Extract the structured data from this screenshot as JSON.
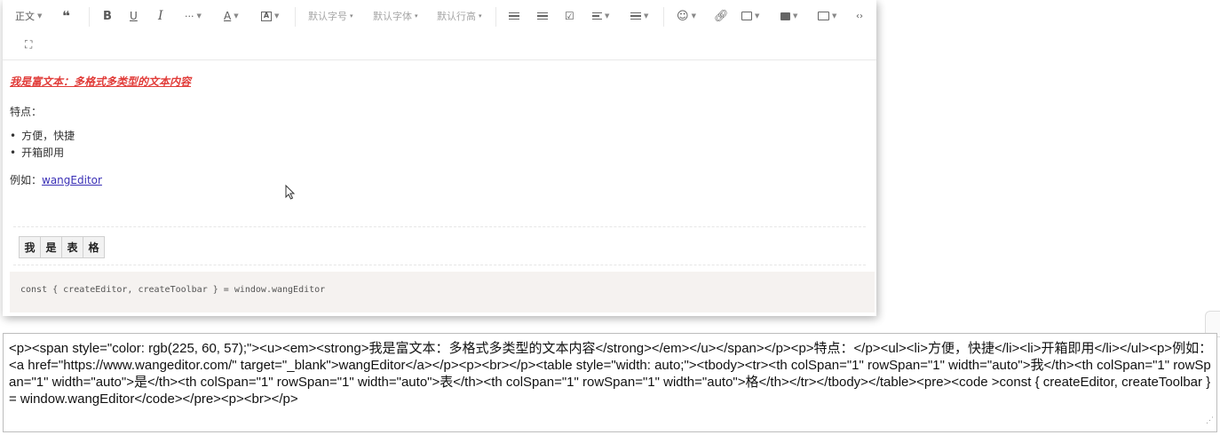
{
  "toolbar": {
    "heading": "正文",
    "font_size": "默认字号",
    "font_family": "默认字体",
    "line_height": "默认行高"
  },
  "content": {
    "title": "我是富文本：多格式多类型的文本内容",
    "features_label": "特点：",
    "bullets": [
      "方便，快捷",
      "开箱即用"
    ],
    "example_prefix": "例如：",
    "example_link": "wangEditor",
    "table_cells": [
      "我",
      "是",
      "表",
      "格"
    ],
    "code": "const { createEditor, createToolbar } = window.wangEditor"
  },
  "colors": {
    "title": "#e13c39",
    "link": "#3a30b6",
    "code_bg": "#f5f2f0"
  },
  "html_output": "<p><span style=\"color: rgb(225, 60, 57);\"><u><em><strong>我是富文本：多格式多类型的文本内容</strong></em></u></span></p><p>特点：</p><ul><li>方便，快捷</li><li>开箱即用</li></ul><p>例如：<a href=\"https://www.wangeditor.com/\" target=\"_blank\">wangEditor</a></p><p><br></p><table style=\"width: auto;\"><tbody><tr><th colSpan=\"1\" rowSpan=\"1\" width=\"auto\">我</th><th colSpan=\"1\" rowSpan=\"1\" width=\"auto\">是</th><th colSpan=\"1\" rowSpan=\"1\" width=\"auto\">表</th><th colSpan=\"1\" rowSpan=\"1\" width=\"auto\">格</th></tr></tbody></table><pre><code >const { createEditor, createToolbar } = window.wangEditor</code></pre><p><br></p>"
}
